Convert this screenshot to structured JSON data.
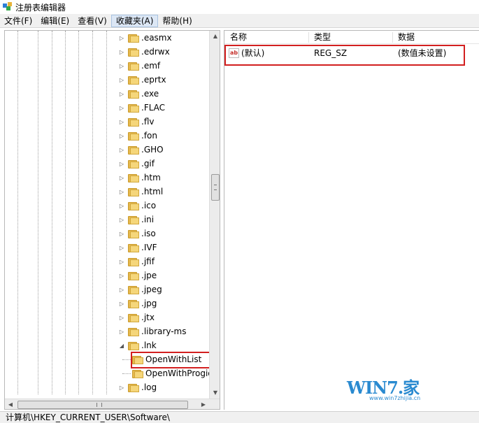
{
  "window": {
    "title": "注册表编辑器",
    "icon": "regedit-icon"
  },
  "menu": [
    "文件(F)",
    "编辑(E)",
    "查看(V)",
    "收藏夹(A)",
    "帮助(H)"
  ],
  "tree": {
    "items": [
      {
        "label": ".easmx",
        "expander": "▷"
      },
      {
        "label": ".edrwx",
        "expander": "▷"
      },
      {
        "label": ".emf",
        "expander": "▷"
      },
      {
        "label": ".eprtx",
        "expander": "▷"
      },
      {
        "label": ".exe",
        "expander": "▷"
      },
      {
        "label": ".FLAC",
        "expander": "▷"
      },
      {
        "label": ".flv",
        "expander": "▷"
      },
      {
        "label": ".fon",
        "expander": "▷"
      },
      {
        "label": ".GHO",
        "expander": "▷"
      },
      {
        "label": ".gif",
        "expander": "▷"
      },
      {
        "label": ".htm",
        "expander": "▷"
      },
      {
        "label": ".html",
        "expander": "▷"
      },
      {
        "label": ".ico",
        "expander": "▷"
      },
      {
        "label": ".ini",
        "expander": "▷"
      },
      {
        "label": ".iso",
        "expander": "▷"
      },
      {
        "label": ".IVF",
        "expander": "▷"
      },
      {
        "label": ".jfif",
        "expander": "▷"
      },
      {
        "label": ".jpe",
        "expander": "▷"
      },
      {
        "label": ".jpeg",
        "expander": "▷"
      },
      {
        "label": ".jpg",
        "expander": "▷"
      },
      {
        "label": ".jtx",
        "expander": "▷"
      },
      {
        "label": ".library-ms",
        "expander": "▷"
      },
      {
        "label": ".lnk",
        "expander": "◢"
      },
      {
        "label": "OpenWithList",
        "expander": ""
      },
      {
        "label": "OpenWithProgids",
        "expander": ""
      },
      {
        "label": ".log",
        "expander": "▷"
      }
    ]
  },
  "list": {
    "columns": [
      "名称",
      "类型",
      "数据"
    ],
    "rows": [
      {
        "name": "(默认)",
        "type": "REG_SZ",
        "data": "(数值未设置)",
        "icon": "string-value-icon"
      }
    ]
  },
  "watermark": {
    "brand": "WIN7.",
    "char": "家",
    "url": "www.win7zhijia.cn"
  },
  "status": "计算机\\HKEY_CURRENT_USER\\Software\\",
  "colors": {
    "highlight": "#d21f1f",
    "folder": "#f5d67a",
    "watermark": "#2a8ad0"
  }
}
